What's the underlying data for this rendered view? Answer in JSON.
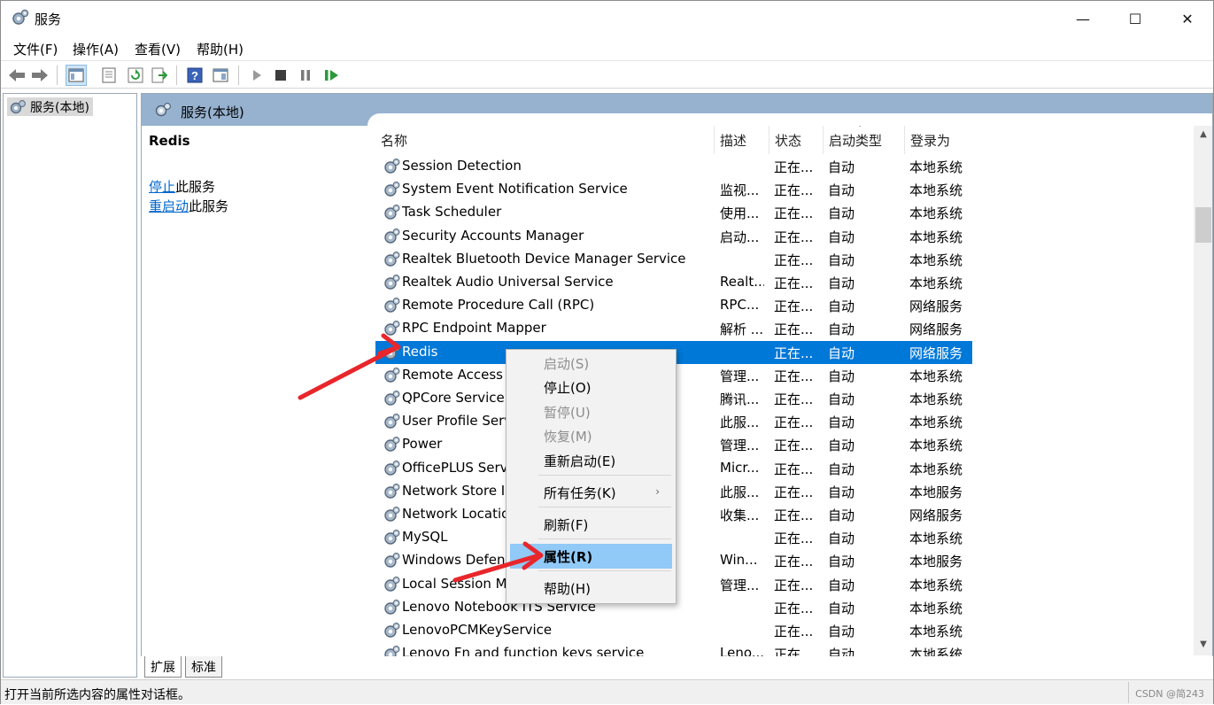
{
  "window": {
    "title": "服务",
    "minimize": "—",
    "maximize": "☐",
    "close": "✕"
  },
  "menu": {
    "file": "文件(F)",
    "action": "操作(A)",
    "view": "查看(V)",
    "help": "帮助(H)"
  },
  "left_pane": {
    "root": "服务(本地)"
  },
  "right_pane": {
    "header": "服务(本地)",
    "selected_service": "Redis",
    "action_stop_link": "停止",
    "action_stop_rest": "此服务",
    "action_restart_link": "重启动",
    "action_restart_rest": "此服务"
  },
  "columns": {
    "name": "名称",
    "desc": "描述",
    "status": "状态",
    "startup": "启动类型",
    "logon": "登录为"
  },
  "services": [
    {
      "name": "Session Detection",
      "desc": "",
      "status": "正在...",
      "startup": "自动",
      "logon": "本地系统"
    },
    {
      "name": "System Event Notification Service",
      "desc": "监视...",
      "status": "正在...",
      "startup": "自动",
      "logon": "本地系统"
    },
    {
      "name": "Task Scheduler",
      "desc": "使用...",
      "status": "正在...",
      "startup": "自动",
      "logon": "本地系统"
    },
    {
      "name": "Security Accounts Manager",
      "desc": "启动...",
      "status": "正在...",
      "startup": "自动",
      "logon": "本地系统"
    },
    {
      "name": "Realtek Bluetooth Device Manager Service",
      "desc": "",
      "status": "正在...",
      "startup": "自动",
      "logon": "本地系统"
    },
    {
      "name": "Realtek Audio Universal Service",
      "desc": "Realt...",
      "status": "正在...",
      "startup": "自动",
      "logon": "本地系统"
    },
    {
      "name": "Remote Procedure Call (RPC)",
      "desc": "RPC...",
      "status": "正在...",
      "startup": "自动",
      "logon": "网络服务"
    },
    {
      "name": "RPC Endpoint Mapper",
      "desc": "解析 ...",
      "status": "正在...",
      "startup": "自动",
      "logon": "网络服务"
    },
    {
      "name": "Redis",
      "desc": "",
      "status": "正在...",
      "startup": "自动",
      "logon": "网络服务"
    },
    {
      "name": "Remote Access Connection Manager",
      "desc": "管理...",
      "status": "正在...",
      "startup": "自动",
      "logon": "本地系统"
    },
    {
      "name": "QPCore Service",
      "desc": "腾讯...",
      "status": "正在...",
      "startup": "自动",
      "logon": "本地系统"
    },
    {
      "name": "User Profile Service",
      "desc": "此服...",
      "status": "正在...",
      "startup": "自动",
      "logon": "本地系统"
    },
    {
      "name": "Power",
      "desc": "管理...",
      "status": "正在...",
      "startup": "自动",
      "logon": "本地系统"
    },
    {
      "name": "OfficePLUS Service",
      "desc": "Micr...",
      "status": "正在...",
      "startup": "自动",
      "logon": "本地系统"
    },
    {
      "name": "Network Store Interface Service",
      "desc": "此服...",
      "status": "正在...",
      "startup": "自动",
      "logon": "本地服务"
    },
    {
      "name": "Network Location Awareness",
      "desc": "收集...",
      "status": "正在...",
      "startup": "自动",
      "logon": "网络服务"
    },
    {
      "name": "MySQL",
      "desc": "",
      "status": "正在...",
      "startup": "自动",
      "logon": "本地系统"
    },
    {
      "name": "Windows Defender Firewall",
      "desc": "Win...",
      "status": "正在...",
      "startup": "自动",
      "logon": "本地服务"
    },
    {
      "name": "Local Session Manager",
      "desc": "管理...",
      "status": "正在...",
      "startup": "自动",
      "logon": "本地系统"
    },
    {
      "name": "Lenovo Notebook ITS Service",
      "desc": "",
      "status": "正在...",
      "startup": "自动",
      "logon": "本地系统"
    },
    {
      "name": "LenovoPCMKeyService",
      "desc": "",
      "status": "正在...",
      "startup": "自动",
      "logon": "本地系统"
    },
    {
      "name": "Lenovo Fn and function keys service",
      "desc": "Leno...",
      "status": "正在...",
      "startup": "自动",
      "logon": "本地系统"
    }
  ],
  "selected_index": 8,
  "context_menu": [
    {
      "label": "启动(S)",
      "disabled": true
    },
    {
      "label": "停止(O)",
      "disabled": false
    },
    {
      "label": "暂停(U)",
      "disabled": true
    },
    {
      "label": "恢复(M)",
      "disabled": true
    },
    {
      "label": "重新启动(E)",
      "disabled": false
    },
    {
      "label": "所有任务(K)",
      "disabled": false,
      "submenu": true
    },
    {
      "label": "刷新(F)",
      "disabled": false
    },
    {
      "label": "属性(R)",
      "disabled": false,
      "highlighted": true
    },
    {
      "label": "帮助(H)",
      "disabled": false
    }
  ],
  "tabs": {
    "extended": "扩展",
    "standard": "标准"
  },
  "status_bar": {
    "text": "打开当前所选内容的属性对话框。",
    "watermark": "CSDN @简243"
  },
  "colors": {
    "selection": "#0078d7",
    "header_band": "#96b2cf",
    "menu_highlight": "#91c9f7",
    "annotation_arrow": "#e8262b"
  }
}
